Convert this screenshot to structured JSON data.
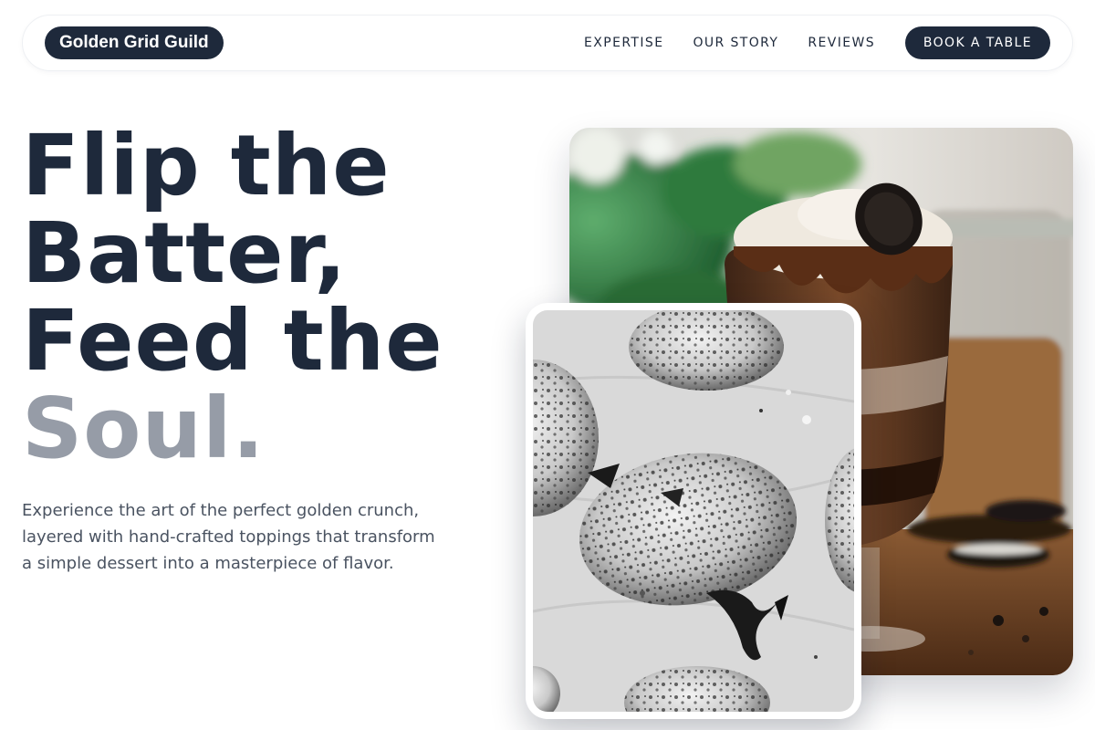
{
  "nav": {
    "logo": "Golden Grid Guild",
    "links": [
      "EXPERTISE",
      "OUR STORY",
      "REVIEWS"
    ],
    "cta": "BOOK A TABLE"
  },
  "hero": {
    "headline_lines": [
      "Flip the",
      "Batter,",
      "Feed the"
    ],
    "headline_accent": "Soul.",
    "description": "Experience the art of the perfect golden crunch, layered with hand-crafted toppings that transform a simple dessert into a masterpiece of flavor."
  },
  "images": {
    "main": "chocolate-cookie-dessert-jar-photo",
    "inset": "grayscale-cookies-on-parchment-photo"
  },
  "colors": {
    "primary": "#1e293b",
    "muted": "#969ca7",
    "body_text": "#4a5361",
    "background": "#ffffff"
  }
}
